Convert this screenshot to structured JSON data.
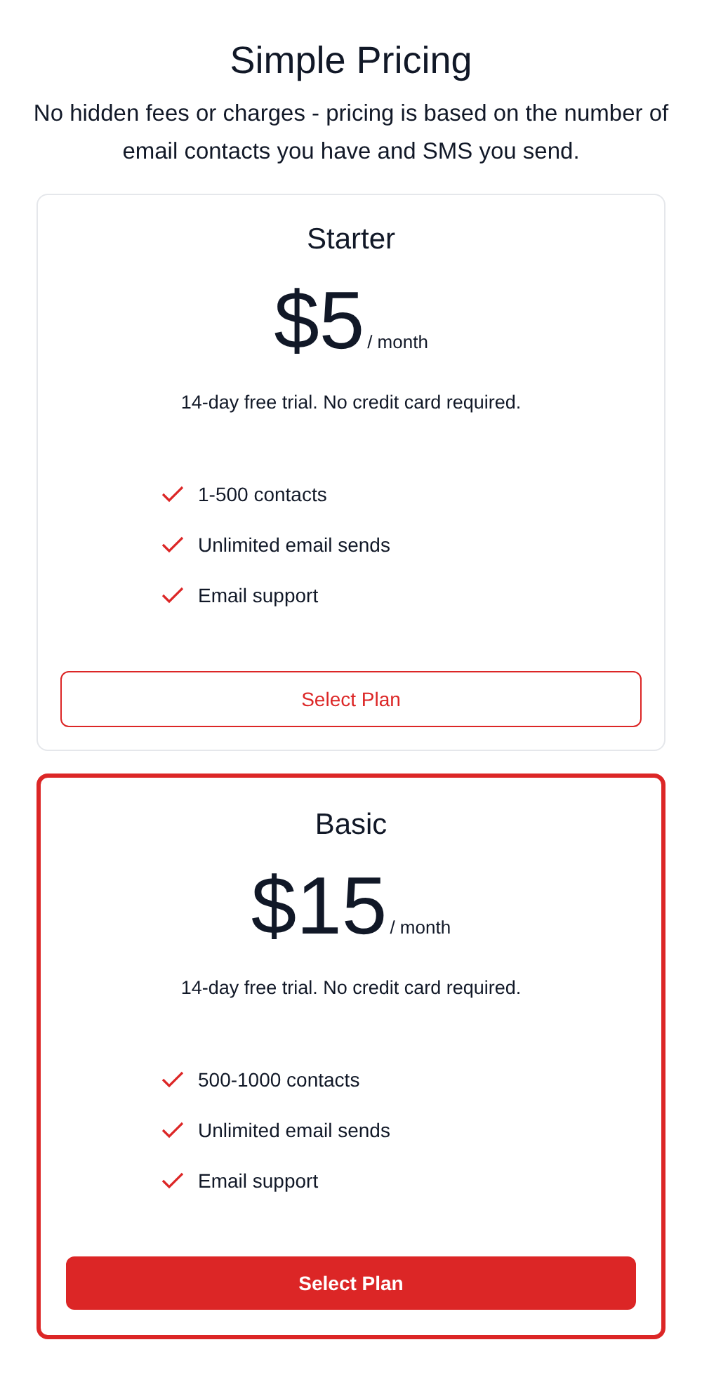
{
  "header": {
    "title": "Simple Pricing",
    "subtitle": "No hidden fees or charges - pricing is based on the number of email contacts you have and SMS you send."
  },
  "plans": [
    {
      "name": "Starter",
      "price": "$5",
      "period": "/ month",
      "trial": "14-day free trial. No credit card required.",
      "features": [
        "1-500 contacts",
        "Unlimited email sends",
        "Email support"
      ],
      "button": "Select Plan",
      "featured": false
    },
    {
      "name": "Basic",
      "price": "$15",
      "period": "/ month",
      "trial": "14-day free trial. No credit card required.",
      "features": [
        "500-1000 contacts",
        "Unlimited email sends",
        "Email support"
      ],
      "button": "Select Plan",
      "featured": true
    }
  ]
}
